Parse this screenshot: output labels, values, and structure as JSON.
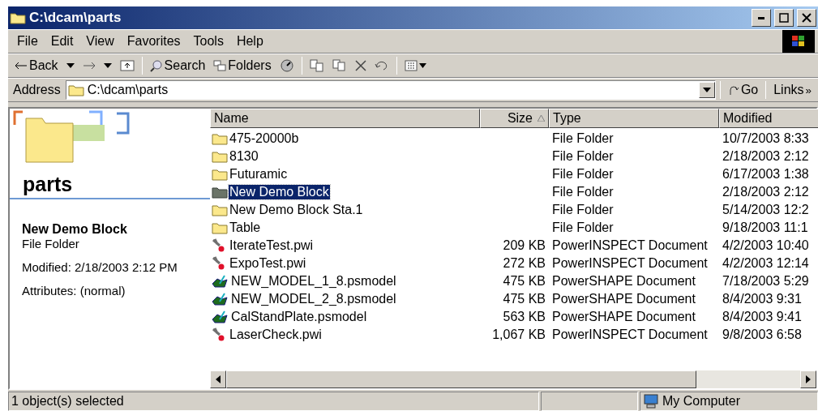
{
  "window": {
    "title": "C:\\dcam\\parts"
  },
  "menu": [
    "File",
    "Edit",
    "View",
    "Favorites",
    "Tools",
    "Help"
  ],
  "toolbar": {
    "back": "Back",
    "search": "Search",
    "folders": "Folders"
  },
  "address": {
    "label": "Address",
    "value": "C:\\dcam\\parts",
    "go": "Go",
    "links": "Links",
    "more": "»"
  },
  "details": {
    "folder": "parts",
    "name": "New Demo Block",
    "type": "File Folder",
    "modified": "Modified: 2/18/2003 2:12 PM",
    "attributes": "Attributes: (normal)"
  },
  "columns": [
    {
      "label": "Name",
      "sorted": false
    },
    {
      "label": "Size",
      "sorted": true
    },
    {
      "label": "Type",
      "sorted": false
    },
    {
      "label": "Modified",
      "sorted": false
    }
  ],
  "rows": [
    {
      "kind": "folder",
      "name": "475-20000b",
      "size": "",
      "type": "File Folder",
      "modified": "10/7/2003 8:33",
      "selected": false
    },
    {
      "kind": "folder",
      "name": "8130",
      "size": "",
      "type": "File Folder",
      "modified": "2/18/2003 2:12",
      "selected": false
    },
    {
      "kind": "folder",
      "name": "Futuramic",
      "size": "",
      "type": "File Folder",
      "modified": "6/17/2003 1:38",
      "selected": false
    },
    {
      "kind": "folder",
      "name": "New Demo Block",
      "size": "",
      "type": "File Folder",
      "modified": "2/18/2003 2:12",
      "selected": true
    },
    {
      "kind": "folder",
      "name": "New Demo Block Sta.1",
      "size": "",
      "type": "File Folder",
      "modified": "5/14/2003 12:2",
      "selected": false
    },
    {
      "kind": "folder",
      "name": "Table",
      "size": "",
      "type": "File Folder",
      "modified": "9/18/2003 11:1",
      "selected": false
    },
    {
      "kind": "probe",
      "name": "IterateTest.pwi",
      "size": "209 KB",
      "type": "PowerINSPECT Document",
      "modified": "4/2/2003 10:40",
      "selected": false
    },
    {
      "kind": "probe",
      "name": "ExpoTest.pwi",
      "size": "272 KB",
      "type": "PowerINSPECT Document",
      "modified": "4/2/2003 12:14",
      "selected": false
    },
    {
      "kind": "model",
      "name": "NEW_MODEL_1_8.psmodel",
      "size": "475 KB",
      "type": "PowerSHAPE Document",
      "modified": "7/18/2003 5:29",
      "selected": false
    },
    {
      "kind": "model",
      "name": "NEW_MODEL_2_8.psmodel",
      "size": "475 KB",
      "type": "PowerSHAPE Document",
      "modified": "8/4/2003 9:31",
      "selected": false
    },
    {
      "kind": "model",
      "name": "CalStandPlate.psmodel",
      "size": "563 KB",
      "type": "PowerSHAPE Document",
      "modified": "8/4/2003 9:41",
      "selected": false
    },
    {
      "kind": "probe",
      "name": "LaserCheck.pwi",
      "size": "1,067 KB",
      "type": "PowerINSPECT Document",
      "modified": "9/8/2003 6:58",
      "selected": false
    }
  ],
  "status": {
    "text": "1 object(s) selected",
    "zone": "My Computer"
  }
}
